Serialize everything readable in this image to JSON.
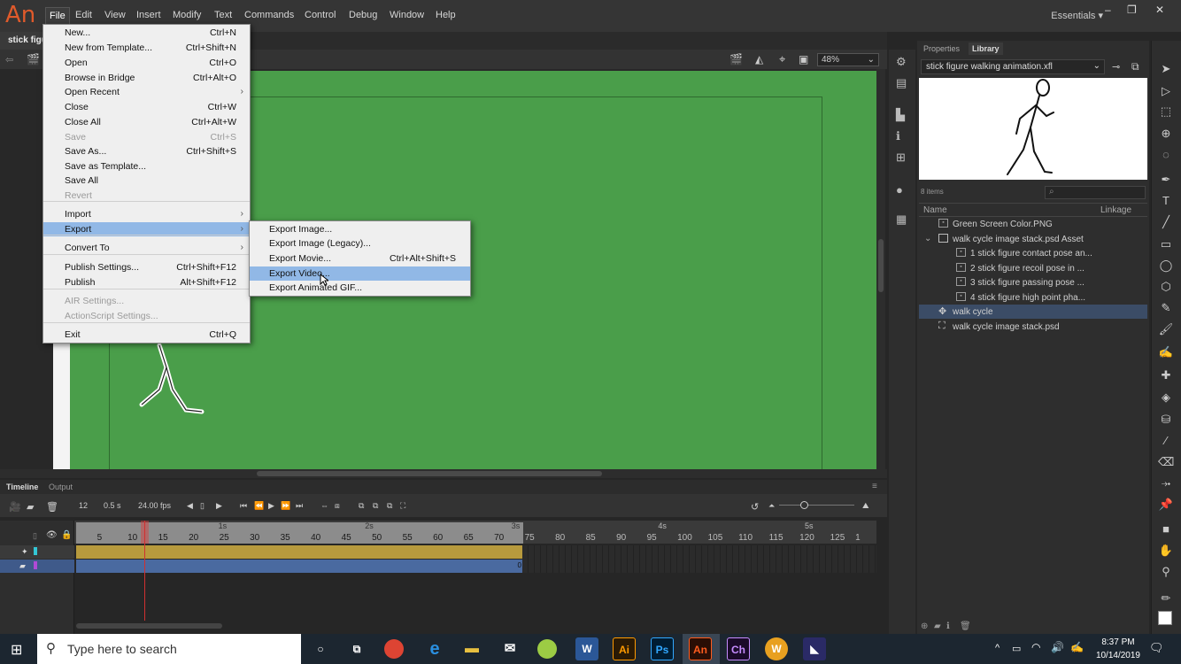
{
  "app": {
    "logo": "An",
    "menus": [
      "File",
      "Edit",
      "View",
      "Insert",
      "Modify",
      "Text",
      "Commands",
      "Control",
      "Debug",
      "Window",
      "Help"
    ],
    "workspace": "Essentials",
    "doc_tab": "stick figu",
    "zoom": "48%"
  },
  "file_menu": [
    {
      "label": "New...",
      "shortcut": "Ctrl+N"
    },
    {
      "label": "New from Template...",
      "shortcut": "Ctrl+Shift+N"
    },
    {
      "label": "Open",
      "shortcut": "Ctrl+O"
    },
    {
      "label": "Browse in Bridge",
      "shortcut": "Ctrl+Alt+O"
    },
    {
      "label": "Open Recent",
      "shortcut": ""
    },
    {
      "label": "Close",
      "shortcut": "Ctrl+W"
    },
    {
      "label": "Close All",
      "shortcut": "Ctrl+Alt+W"
    },
    {
      "label": "Save",
      "shortcut": "Ctrl+S"
    },
    {
      "label": "Save As...",
      "shortcut": "Ctrl+Shift+S"
    },
    {
      "label": "Save as Template...",
      "shortcut": ""
    },
    {
      "label": "Save All",
      "shortcut": ""
    },
    {
      "label": "Revert",
      "shortcut": ""
    },
    {
      "label": "Import",
      "shortcut": ""
    },
    {
      "label": "Export",
      "shortcut": ""
    },
    {
      "label": "Convert To",
      "shortcut": ""
    },
    {
      "label": "Publish Settings...",
      "shortcut": "Ctrl+Shift+F12"
    },
    {
      "label": "Publish",
      "shortcut": "Alt+Shift+F12"
    },
    {
      "label": "AIR Settings...",
      "shortcut": ""
    },
    {
      "label": "ActionScript Settings...",
      "shortcut": ""
    },
    {
      "label": "Exit",
      "shortcut": "Ctrl+Q"
    }
  ],
  "export_submenu": [
    {
      "label": "Export Image...",
      "shortcut": ""
    },
    {
      "label": "Export Image (Legacy)...",
      "shortcut": ""
    },
    {
      "label": "Export Movie...",
      "shortcut": "Ctrl+Alt+Shift+S"
    },
    {
      "label": "Export Video...",
      "shortcut": ""
    },
    {
      "label": "Export Animated GIF...",
      "shortcut": ""
    }
  ],
  "library": {
    "tabs": [
      "Properties",
      "Library"
    ],
    "file": "stick figure walking animation.xfl",
    "count": "8 items",
    "col_name": "Name",
    "col_linkage": "Linkage",
    "items": [
      {
        "name": "Green Screen Color.PNG"
      },
      {
        "name": "walk cycle image stack.psd Asset"
      },
      {
        "name": "1 stick figure contact pose an..."
      },
      {
        "name": "2 stick figure recoil pose in ..."
      },
      {
        "name": "3 stick figure passing pose ..."
      },
      {
        "name": "4 stick figure high point pha..."
      },
      {
        "name": "walk cycle"
      },
      {
        "name": "walk cycle image stack.psd"
      }
    ]
  },
  "timeline": {
    "tabs": [
      "Timeline",
      "Output"
    ],
    "current_frame": "12",
    "time": "0.5 s",
    "fps": "24.00",
    "fps_unit": "fps",
    "frame_ticks": [
      "5",
      "10",
      "15",
      "20",
      "25",
      "30",
      "35",
      "40",
      "45",
      "50",
      "55",
      "60",
      "65",
      "70",
      "75",
      "80",
      "85",
      "90",
      "95",
      "100",
      "105",
      "110",
      "115",
      "120",
      "125",
      "1"
    ],
    "second_marks": [
      "1s",
      "2s",
      "3s",
      "4s",
      "5s"
    ],
    "span_end_label": "0"
  },
  "taskbar": {
    "search_placeholder": "Type here to search",
    "time": "8:37 PM",
    "date": "10/14/2019",
    "apps": [
      "Ai",
      "Ps",
      "An",
      "Ch",
      "W"
    ]
  }
}
